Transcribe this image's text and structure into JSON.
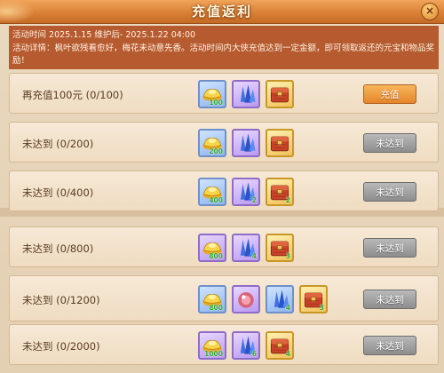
{
  "window": {
    "title": "充值返利",
    "close_icon": "close-icon"
  },
  "info": {
    "time_line": "活动时间 2025.1.15 维护后- 2025.1.22 04:00",
    "detail_line": "活动详情：枫叶欲残看愈好，梅花未动意先香。活动时间内大侠充值达到一定金额，即可领取返还的元宝和物品奖励！"
  },
  "colors": {
    "header": "#d77d33",
    "active_button": "#e5862b",
    "disabled_button": "#8d8d8d",
    "count_text": "#2fa72f"
  },
  "tiers": [
    {
      "label": "再充值100元 (0/100)",
      "button": "充值",
      "button_state": "active",
      "rewards": [
        {
          "icon": "gold-ingot-icon",
          "frame": "blue",
          "count": "100"
        },
        {
          "icon": "blue-crystal-icon",
          "frame": "purple",
          "count": ""
        },
        {
          "icon": "red-treasure-box-icon",
          "frame": "gold",
          "count": ""
        }
      ]
    },
    {
      "label": "未达到 (0/200)",
      "button": "未达到",
      "button_state": "disabled",
      "rewards": [
        {
          "icon": "gold-ingot-icon",
          "frame": "blue",
          "count": "200"
        },
        {
          "icon": "blue-crystal-icon",
          "frame": "purple",
          "count": ""
        },
        {
          "icon": "red-treasure-box-icon",
          "frame": "gold",
          "count": ""
        }
      ]
    },
    {
      "label": "未达到 (0/400)",
      "button": "未达到",
      "button_state": "disabled",
      "rewards": [
        {
          "icon": "gold-ingot-icon",
          "frame": "blue",
          "count": "400"
        },
        {
          "icon": "blue-crystal-icon",
          "frame": "purple",
          "count": "2"
        },
        {
          "icon": "red-treasure-box-icon",
          "frame": "gold",
          "count": "2"
        }
      ]
    },
    {
      "label": "未达到 (0/800)",
      "button": "未达到",
      "button_state": "disabled",
      "rewards": [
        {
          "icon": "gold-ingot-icon",
          "frame": "purple",
          "count": "800"
        },
        {
          "icon": "blue-crystal-icon",
          "frame": "purple",
          "count": "4"
        },
        {
          "icon": "red-treasure-box-icon",
          "frame": "gold",
          "count": "3"
        }
      ]
    },
    {
      "label": "未达到 (0/1200)",
      "button": "未达到",
      "button_state": "disabled",
      "rewards": [
        {
          "icon": "gold-ingot-icon",
          "frame": "blue",
          "count": "800"
        },
        {
          "icon": "pink-orb-icon",
          "frame": "purple",
          "count": ""
        },
        {
          "icon": "blue-crystal-icon",
          "frame": "blue",
          "count": "4"
        },
        {
          "icon": "red-treasure-box-icon",
          "frame": "gold",
          "count": "3"
        }
      ]
    },
    {
      "label": "未达到 (0/2000)",
      "button": "未达到",
      "button_state": "disabled",
      "rewards": [
        {
          "icon": "gold-ingot-icon",
          "frame": "purple",
          "count": "1000"
        },
        {
          "icon": "blue-crystal-icon",
          "frame": "purple",
          "count": "6"
        },
        {
          "icon": "red-treasure-box-icon",
          "frame": "gold",
          "count": "4"
        }
      ]
    }
  ]
}
